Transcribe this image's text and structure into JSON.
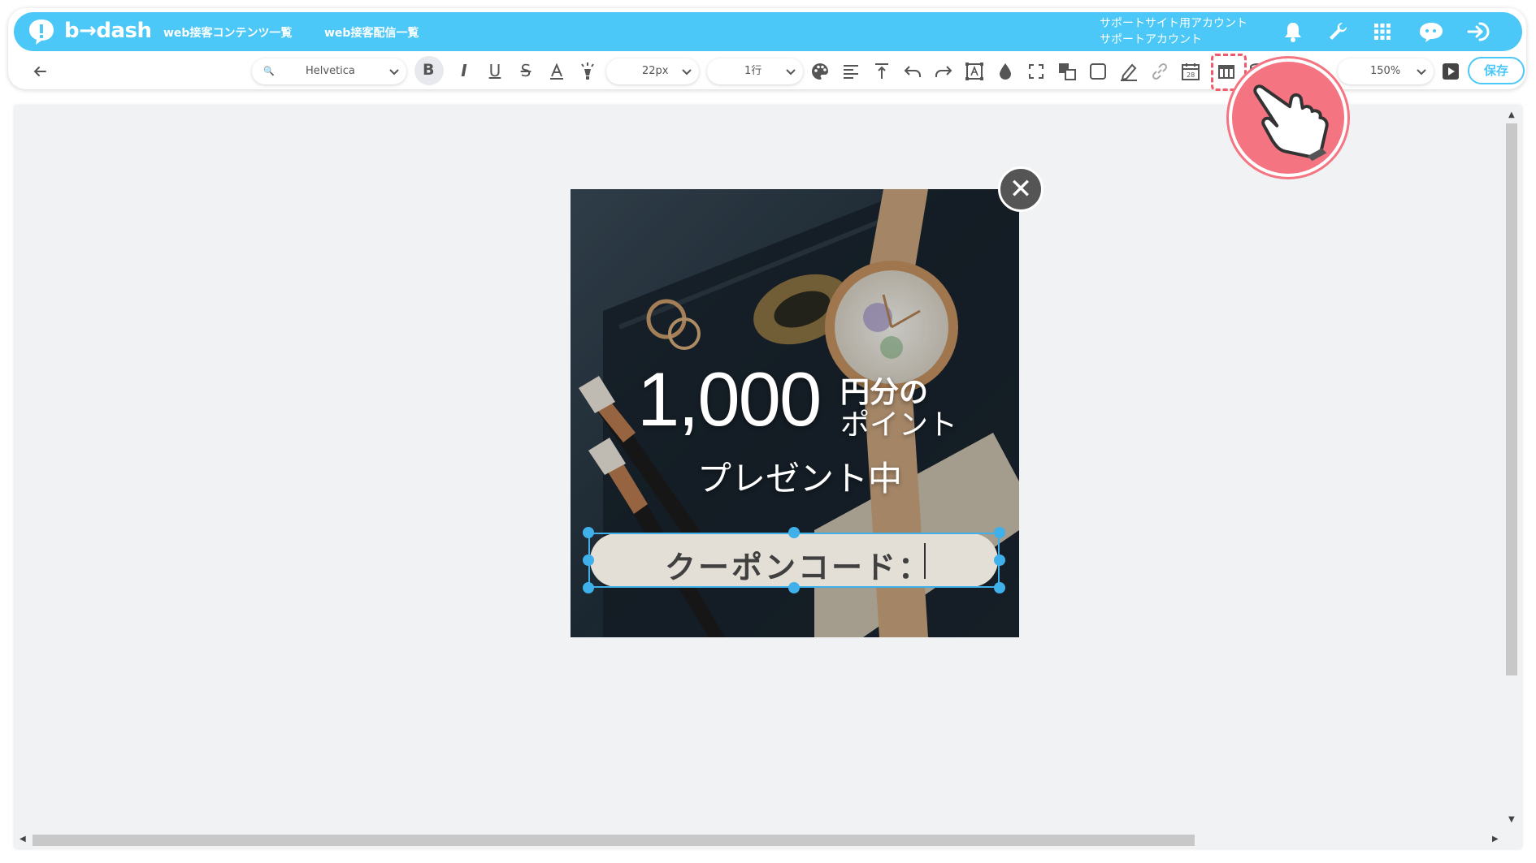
{
  "header": {
    "logo_text": "b→dash",
    "nav": [
      {
        "label": "web接客コンテンツ一覧"
      },
      {
        "label": "web接客配信一覧"
      }
    ],
    "account": {
      "line1": "サポートサイト用アカウント",
      "line2": "サポートアカウント"
    },
    "icons": [
      "bell-icon",
      "wrench-icon",
      "apps-grid-icon",
      "support-chat-icon",
      "logout-icon"
    ]
  },
  "toolbar": {
    "font_family": "Helvetica",
    "font_size": "22px",
    "line_height": "1行",
    "zoom": "150%",
    "save_label": "保存",
    "bold_active": true,
    "highlighted_tool": "table-icon"
  },
  "banner": {
    "amount": "1,000",
    "unit_line1": "円分の",
    "unit_line2": "ポイント",
    "subtitle": "プレゼント中",
    "coupon_label": "クーポンコード："
  },
  "colors": {
    "brand": "#4bc8f7",
    "selection": "#3fb0ea",
    "highlight": "#f15a6b",
    "pointer": "#f47482"
  }
}
